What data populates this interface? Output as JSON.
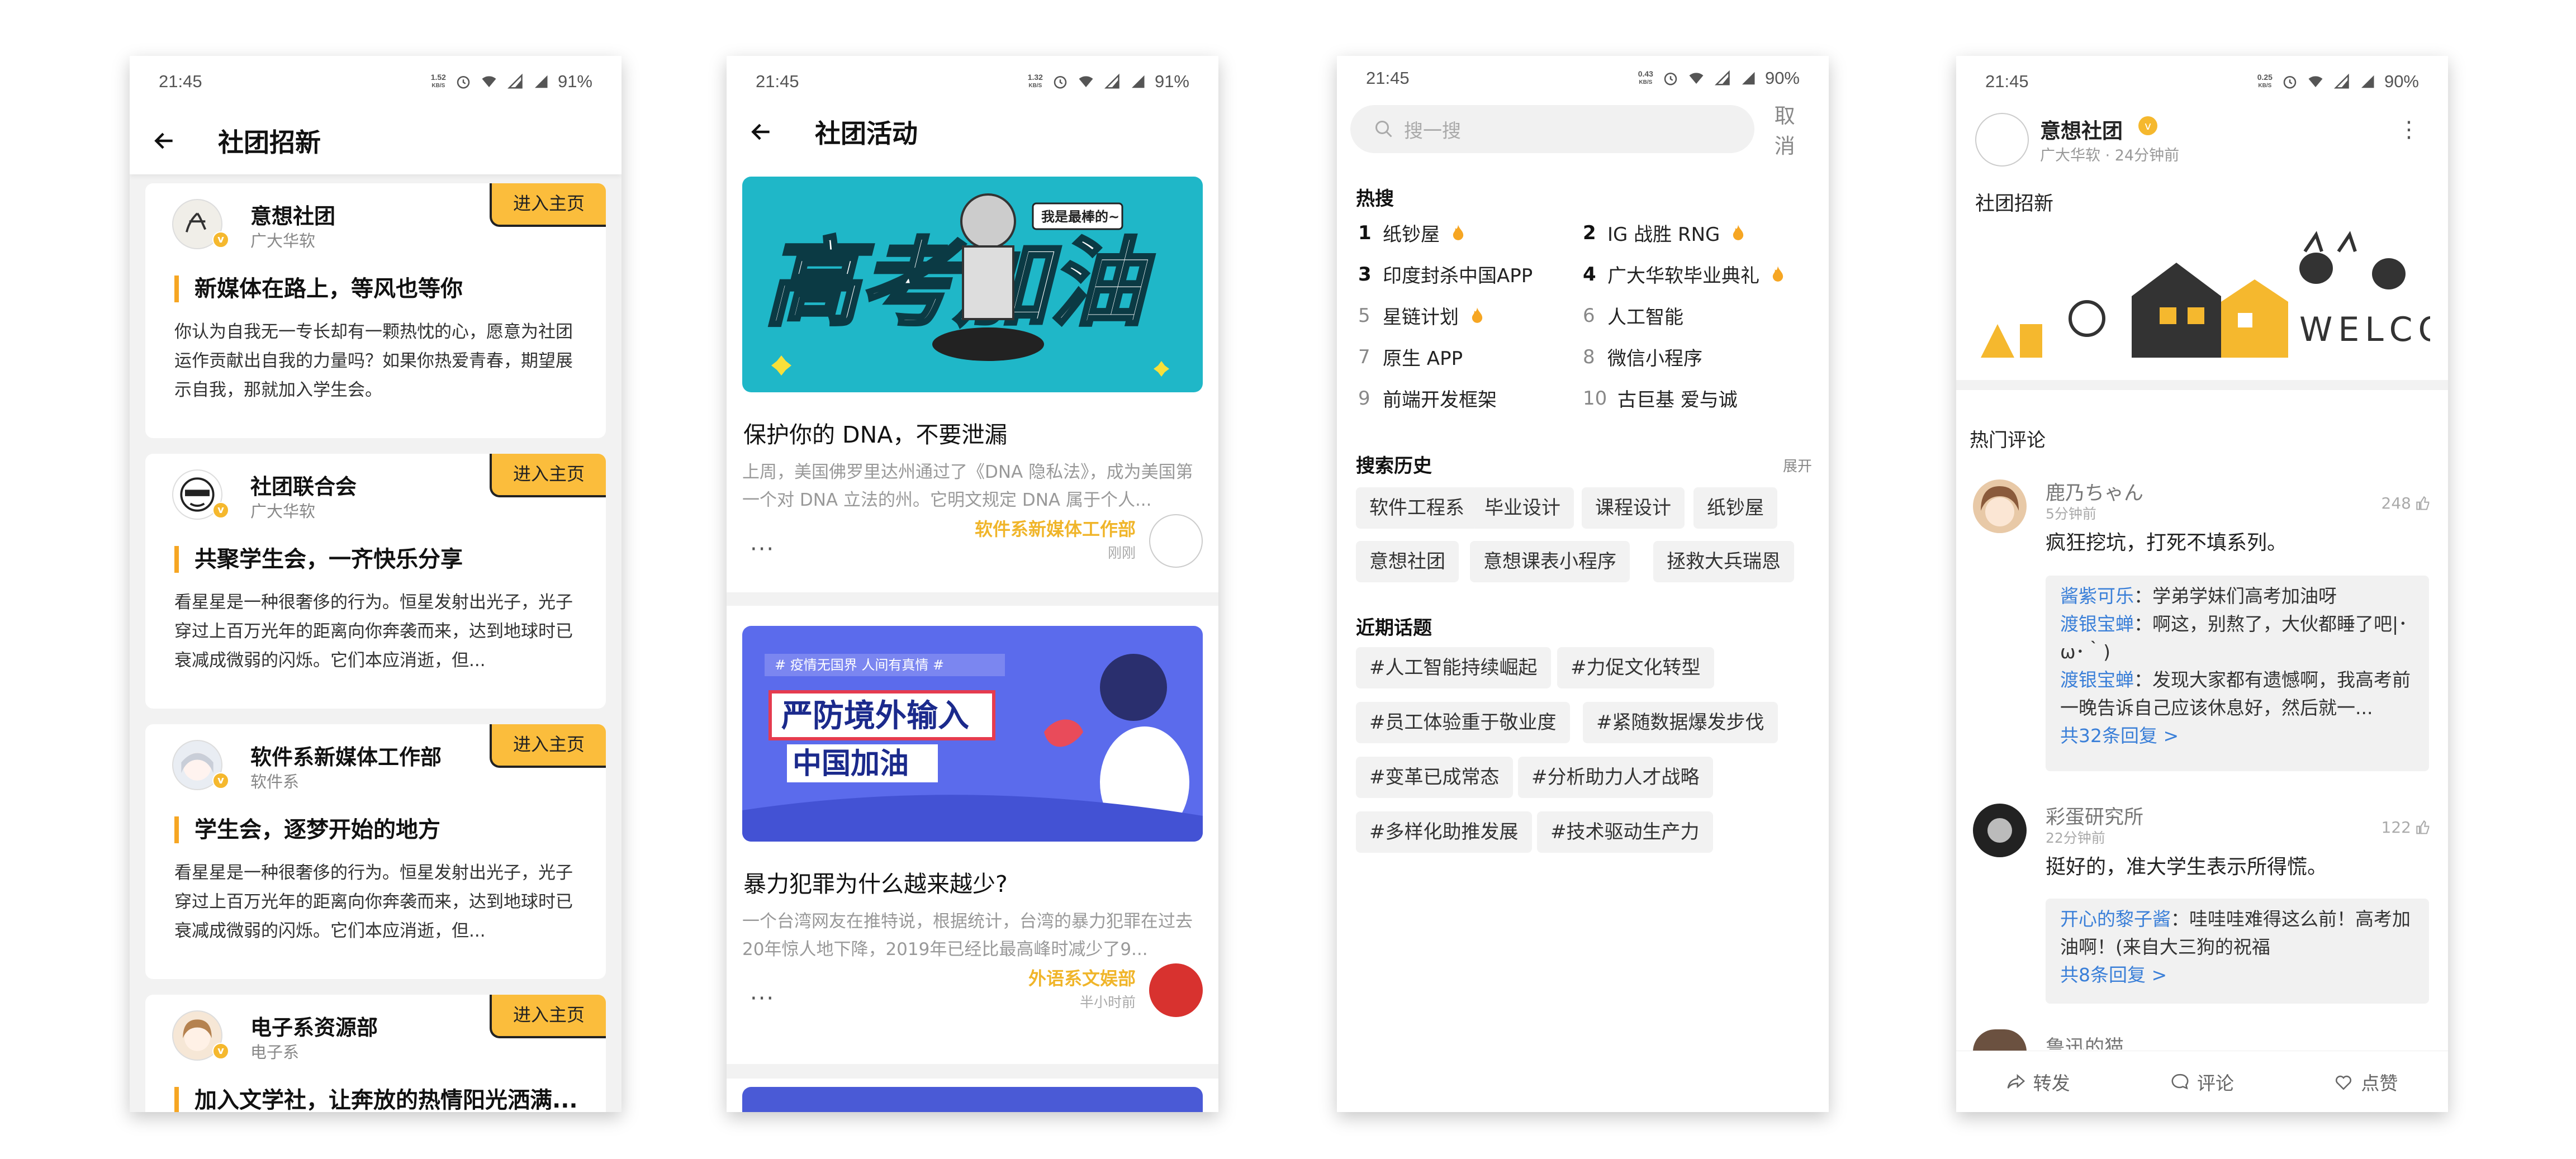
{
  "phone1": {
    "status": {
      "time": "21:45",
      "speed_top": "1.52",
      "speed_unit": "KB/S",
      "battery": "91%"
    },
    "title": "社团招新",
    "enter_label": "进入主页",
    "cards": [
      {
        "name": "意想社团",
        "sub": "广大华软",
        "headline": "新媒体在路上，等风也等你",
        "body": "你认为自我无一专长却有一颗热忱的心，愿意为社团运作贡献出自我的力量吗？如果你热爱青春，期望展示自我，那就加入学生会。"
      },
      {
        "name": "社团联合会",
        "sub": "广大华软",
        "headline": "共聚学生会，一齐快乐分享",
        "body": "看星星是一种很奢侈的行为。恒星发射出光子，光子穿过上百万光年的距离向你奔袭而来，达到地球时已衰减成微弱的闪烁。它们本应消逝，但..."
      },
      {
        "name": "软件系新媒体工作部",
        "sub": "软件系",
        "headline": "学生会，逐梦开始的地方",
        "body": "看星星是一种很奢侈的行为。恒星发射出光子，光子穿过上百万光年的距离向你奔袭而来，达到地球时已衰减成微弱的闪烁。它们本应消逝，但..."
      },
      {
        "name": "电子系资源部",
        "sub": "电子系",
        "headline": "加入文学社，让奔放的热情阳光洒满...",
        "body": ""
      }
    ]
  },
  "phone2": {
    "status": {
      "time": "21:45",
      "speed_top": "1.32",
      "speed_unit": "KB/S",
      "battery": "91%"
    },
    "title": "社团活动",
    "articles": [
      {
        "banner_main": "高考加油",
        "banner_bubble": "我是最棒的~",
        "title": "保护你的 DNA，不要泄漏",
        "desc": "上周，美国佛罗里达州通过了《DNA 隐私法》，成为美国第一个对 DNA 立法的州。它明文规定 DNA 属于个人...",
        "author": "软件系新媒体工作部",
        "time": "刚刚"
      },
      {
        "banner_tag": "# 疫情无国界 人间有真情 #",
        "banner_line1": "严防境外输入",
        "banner_line2": "中国加油",
        "title": "暴力犯罪为什么越来越少?",
        "desc": "一个台湾网友在推特说，根据统计，台湾的暴力犯罪在过去20年惊人地下降，2019年已经比最高峰时减少了9...",
        "author": "外语系文娱部",
        "time": "半小时前"
      }
    ],
    "more": "···"
  },
  "phone3": {
    "status": {
      "time": "21:45",
      "speed_top": "0.43",
      "speed_unit": "KB/S",
      "battery": "90%"
    },
    "search_placeholder": "搜一搜",
    "cancel": "取消",
    "hot_title": "热搜",
    "hot": [
      {
        "n": "1",
        "text": "纸钞屋",
        "flame": true
      },
      {
        "n": "2",
        "text": "IG 战胜 RNG",
        "flame": true
      },
      {
        "n": "3",
        "text": "印度封杀中国APP",
        "flame": false
      },
      {
        "n": "4",
        "text": "广大华软毕业典礼",
        "flame": true
      },
      {
        "n": "5",
        "text": "星链计划",
        "flame": true
      },
      {
        "n": "6",
        "text": "人工智能",
        "flame": false
      },
      {
        "n": "7",
        "text": "原生 APP",
        "flame": false
      },
      {
        "n": "8",
        "text": "微信小程序",
        "flame": false
      },
      {
        "n": "9",
        "text": "前端开发框架",
        "flame": false
      },
      {
        "n": "10",
        "text": "古巨基 爱与诚",
        "flame": false
      }
    ],
    "history_title": "搜索历史",
    "expand": "展开",
    "history": [
      "软件工程系",
      "毕业设计",
      "课程设计",
      "纸钞屋",
      "意想社团",
      "意想课表小程序",
      "拯救大兵瑞恩"
    ],
    "topics_title": "近期话题",
    "topics": [
      "#人工智能持续崛起",
      "#力促文化转型",
      "#员工体验重于敬业度",
      "#紧随数据爆发步伐",
      "#变革已成常态",
      "#分析助力人才战略",
      "#多样化助推发展",
      "#技术驱动生产力"
    ]
  },
  "phone4": {
    "status": {
      "time": "21:45",
      "speed_top": "0.25",
      "speed_unit": "KB/S",
      "battery": "90%"
    },
    "name": "意想社团",
    "meta": "广大华软 · 24分钟前",
    "post_text": "社团招新",
    "image_text": "WELCOME",
    "hot_comments": "热门评论",
    "comments": [
      {
        "name": "鹿乃ちゃん",
        "time": "5分钟前",
        "likes": "248",
        "text": "疯狂挖坑，打死不填系列。",
        "replies": [
          {
            "who": "酱紫可乐",
            "text": "：学弟学妹们高考加油呀"
          },
          {
            "who": "渡银宝蝉",
            "text": "：啊这，别熬了，大伙都睡了吧|･ω･｀)"
          },
          {
            "who": "渡银宝蝉",
            "text": "：发现大家都有遗憾啊，我高考前一晚告诉自己应该休息好，然后就一..."
          }
        ],
        "more": "共32条回复 >"
      },
      {
        "name": "彩蛋研究所",
        "time": "22分钟前",
        "likes": "122",
        "text": "挺好的，准大学生表示所得慌。",
        "replies": [
          {
            "who": "开心的黎子酱",
            "text": "：哇哇哇难得这么前！高考加油啊！(来自大三狗的祝福"
          }
        ],
        "more": "共8条回复 >"
      },
      {
        "name": "鲁迅的猫",
        "time": "",
        "likes": "",
        "text": "",
        "replies": [],
        "more": ""
      }
    ],
    "actions": {
      "share": "转发",
      "comment": "评论",
      "like": "点赞"
    }
  }
}
